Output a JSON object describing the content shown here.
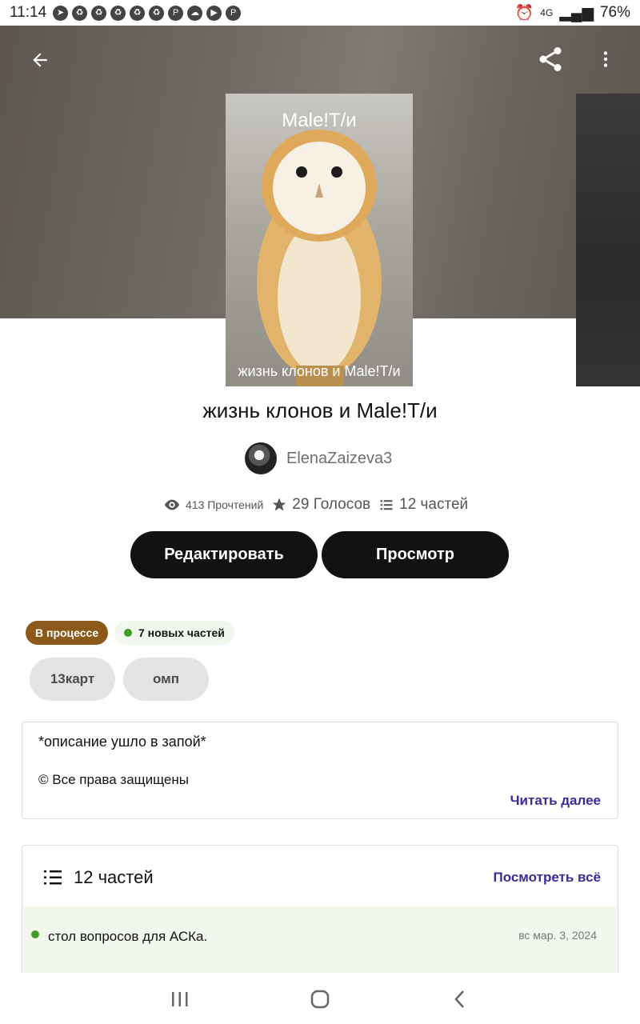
{
  "status_bar": {
    "time": "11:14",
    "network": "4G",
    "battery": "76%"
  },
  "story": {
    "cover_title": "Male!T/и",
    "cover_subtitle": "жизнь клонов и Male!T/и",
    "title": "жизнь клонов и Male!T/и",
    "author": "ElenaZaizeva3",
    "stats": {
      "reads": "413 Прочтений",
      "votes": "29 Голосов",
      "parts": "12 частей"
    }
  },
  "buttons": {
    "edit": "Редактировать",
    "view": "Просмотр"
  },
  "badges": {
    "status": "В процессе",
    "new_parts": "7 новых частей"
  },
  "tags": [
    "13карт",
    "омп"
  ],
  "description": {
    "line1": "*описание ушло в запой*",
    "line2": "© Все права защищены",
    "read_more": "Читать далее"
  },
  "parts_section": {
    "title": "12 частей",
    "see_all": "Посмотреть всё",
    "items": [
      {
        "title": "стол вопросов для АСКа.",
        "date": "вс мар. 3, 2024"
      }
    ]
  },
  "icons": {
    "back": "arrow-left-icon",
    "share": "share-icon",
    "more": "more-vertical-icon",
    "views": "eye-icon",
    "votes": "star-icon",
    "parts": "list-icon"
  },
  "colors": {
    "accent": "#3b2a9c",
    "status_badge": "#8b5a1b",
    "new_dot": "#3f9e25",
    "primary_button": "#121212"
  }
}
